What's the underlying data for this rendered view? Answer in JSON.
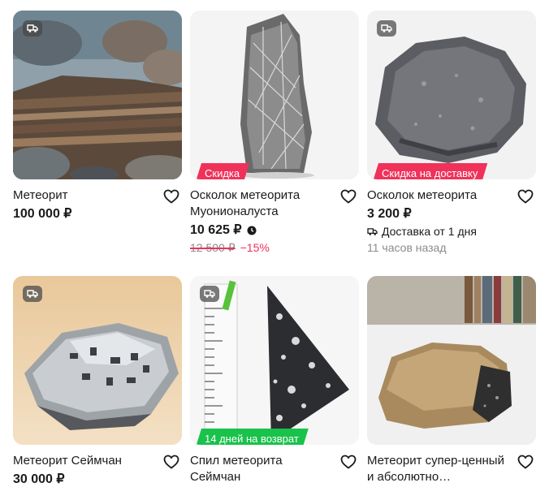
{
  "colors": {
    "discount_red": "#f0325a",
    "return_green": "#19c24a",
    "muted_gray": "#8b8b8b"
  },
  "listings": [
    {
      "title": "Метеорит",
      "price": "100 000 ₽",
      "has_delivery_icon": true,
      "image": "layered-stone-on-shore"
    },
    {
      "title": "Осколок метеорита Муонионалуста",
      "price": "10 625 ₽",
      "promo": "Скидка",
      "old_price": "12 500 ₽",
      "discount": "−15%",
      "has_delivery_icon": false,
      "image": "etched-metal-slab"
    },
    {
      "title": "Осколок метеорита",
      "price": "3 200 ₽",
      "promo": "Скидка на доставку",
      "delivery": "Доставка от 1 дня",
      "time_ago": "11 часов назад",
      "has_delivery_icon": true,
      "image": "gray-rock"
    },
    {
      "title": "Метеорит Сеймчан",
      "price": "30 000 ₽",
      "has_delivery_icon": true,
      "image": "silver-metal-fragment"
    },
    {
      "title": "Спил метеорита Сеймчан",
      "promo": "14 дней на возврат",
      "has_delivery_icon": true,
      "image": "slice-with-ruler"
    },
    {
      "title": "Метеорит супер-ценный и абсолютно…",
      "has_delivery_icon": false,
      "image": "brown-crusted-stone"
    }
  ]
}
